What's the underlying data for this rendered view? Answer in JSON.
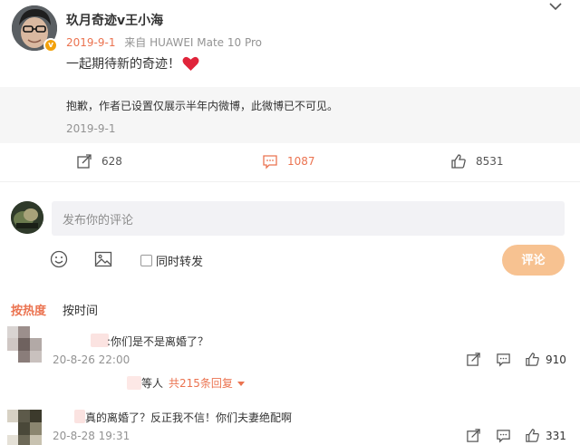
{
  "post": {
    "author": "玖月奇迹v王小海",
    "date": "2019-9-1",
    "source": "来自 HUAWEI Mate 10 Pro",
    "text": "一起期待新的奇迹！",
    "heart_icon": "red-heart-icon",
    "verified_badge": "v"
  },
  "retweet": {
    "message": "抱歉，作者已设置仅展示半年内微博，此微博已不可见。",
    "date": "2019-9-1"
  },
  "actions": {
    "forward_count": "628",
    "comment_count": "1087",
    "like_count": "8531",
    "accent_color": "#eb7350"
  },
  "composer": {
    "placeholder": "发布你的评论",
    "forward_label": "同时转发",
    "submit_label": "评论"
  },
  "sort": {
    "hot": "按热度",
    "time": "按时间"
  },
  "comments": [
    {
      "text": ":你们是不是离婚了？",
      "date": "20-8-26 22:00",
      "likes": "910",
      "reply_suffix": "等人",
      "reply_link": "共215条回复"
    },
    {
      "text": "真的离婚了？反正我不信！你们夫妻绝配啊",
      "date": "20-8-28 19:31",
      "likes": "331"
    }
  ]
}
